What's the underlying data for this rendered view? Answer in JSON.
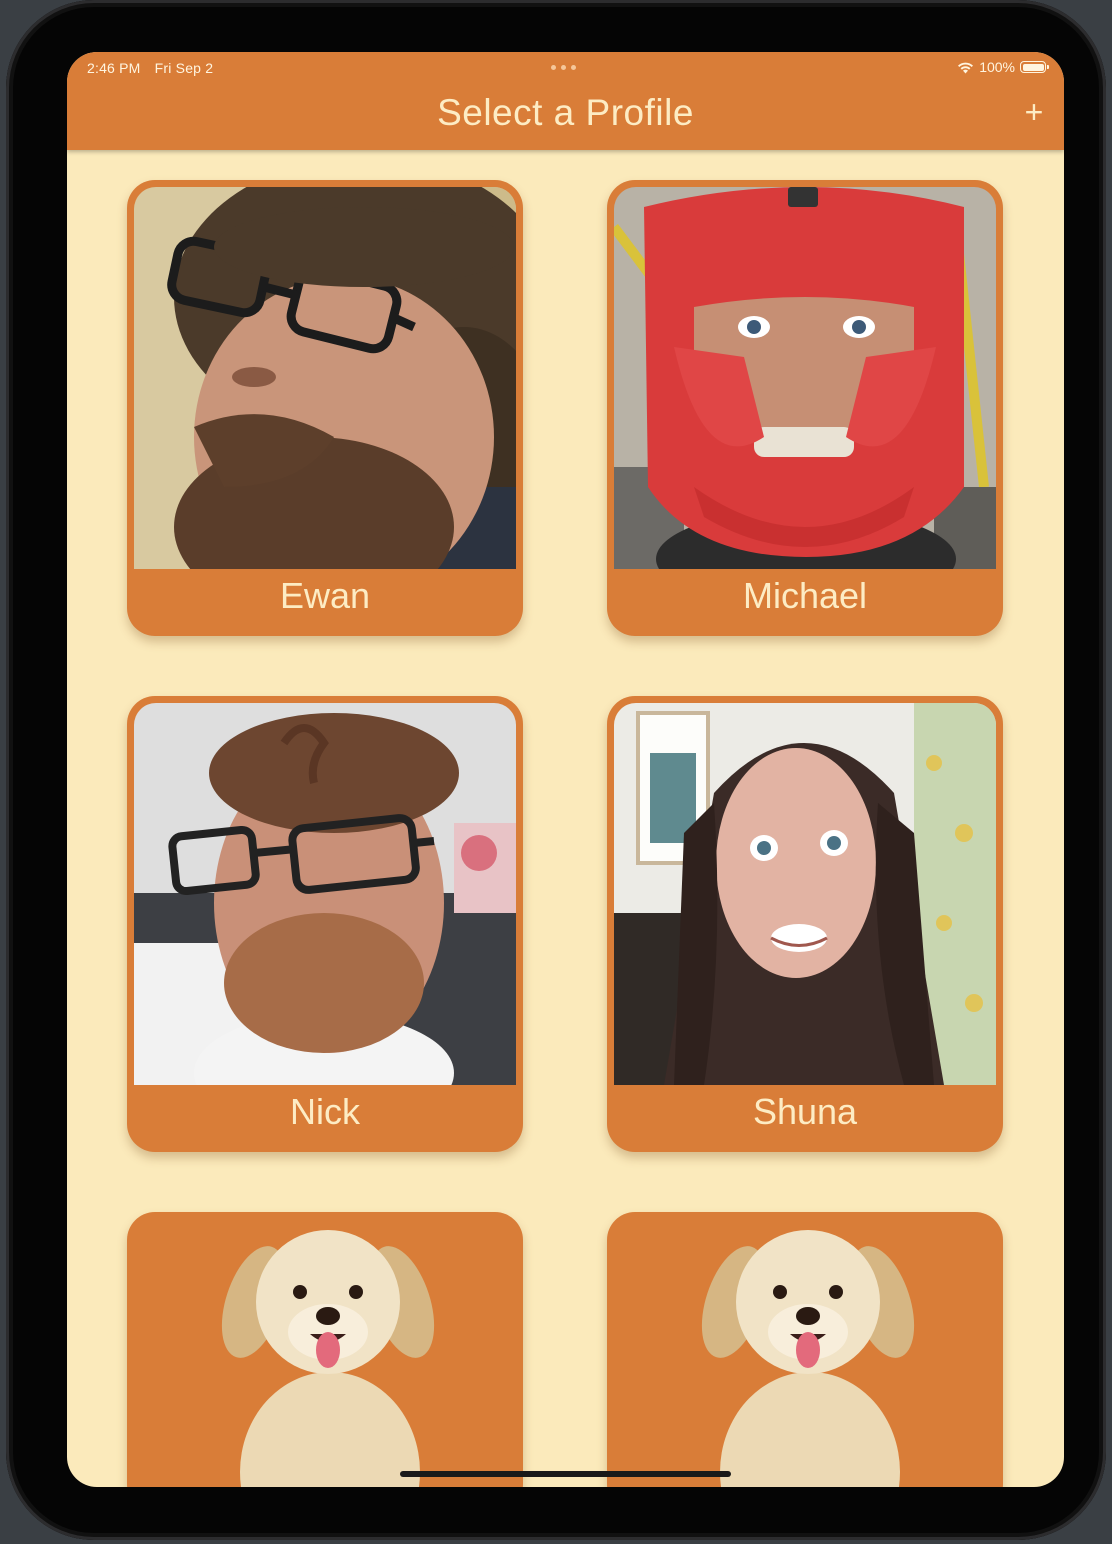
{
  "status_bar": {
    "time": "2:46 PM",
    "date": "Fri Sep 2",
    "battery": "100%"
  },
  "nav": {
    "title": "Select a Profile",
    "add_label": "+"
  },
  "profiles": [
    {
      "name": "Ewan"
    },
    {
      "name": "Michael"
    },
    {
      "name": "Nick"
    },
    {
      "name": "Shuna"
    }
  ],
  "colors": {
    "accent": "#d97d38",
    "background": "#fbeabb",
    "label": "#fdecc4"
  }
}
